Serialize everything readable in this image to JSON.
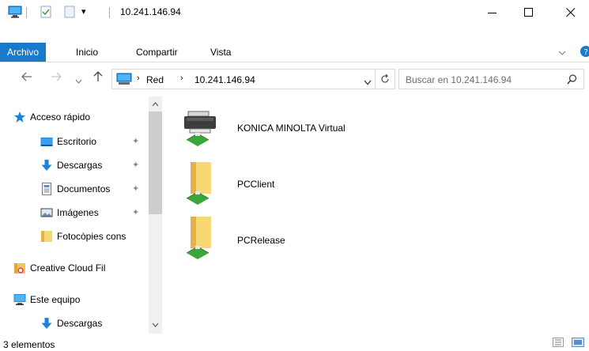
{
  "window": {
    "title": "10.241.146.94",
    "minimize_glyph": "—",
    "maximize_glyph": "☐",
    "close_glyph": "✕"
  },
  "ribbon": {
    "tabs": [
      {
        "label": "Archivo",
        "active": true
      },
      {
        "label": "Inicio",
        "active": false
      },
      {
        "label": "Compartir",
        "active": false
      },
      {
        "label": "Vista",
        "active": false
      }
    ],
    "expand_glyph": "﹀"
  },
  "address": {
    "crumbs": [
      "Red",
      "10.241.146.94"
    ],
    "search_placeholder": "Buscar en 10.241.146.94"
  },
  "nav": {
    "items": [
      {
        "label": "Acceso rápido",
        "icon": "star-icon",
        "pinned": false
      },
      {
        "label": "Escritorio",
        "icon": "desktop-icon",
        "pinned": true
      },
      {
        "label": "Descargas",
        "icon": "download-arrow-icon",
        "pinned": true
      },
      {
        "label": "Documentos",
        "icon": "document-icon",
        "pinned": true
      },
      {
        "label": "Imágenes",
        "icon": "pictures-icon",
        "pinned": true
      },
      {
        "label": "Fotocòpies cons",
        "icon": "folder-icon",
        "pinned": false
      },
      {
        "label": "Creative Cloud Fil",
        "icon": "creative-cloud-folder-icon",
        "pinned": false
      },
      {
        "label": "Este equipo",
        "icon": "computer-icon",
        "pinned": false
      },
      {
        "label": "Descargas",
        "icon": "download-arrow-icon",
        "pinned": false
      }
    ]
  },
  "content": {
    "items": [
      {
        "label": "KONICA MINOLTA Virtual",
        "icon": "network-printer-icon"
      },
      {
        "label": "PCClient",
        "icon": "network-share-folder-icon"
      },
      {
        "label": "PCRelease",
        "icon": "network-share-folder-icon"
      }
    ]
  },
  "status": {
    "count_text": "3 elementos"
  },
  "colors": {
    "accent": "#1979ca",
    "folder": "#f8d775",
    "folder_dark": "#e3b24a",
    "network_green": "#3aa63a"
  }
}
